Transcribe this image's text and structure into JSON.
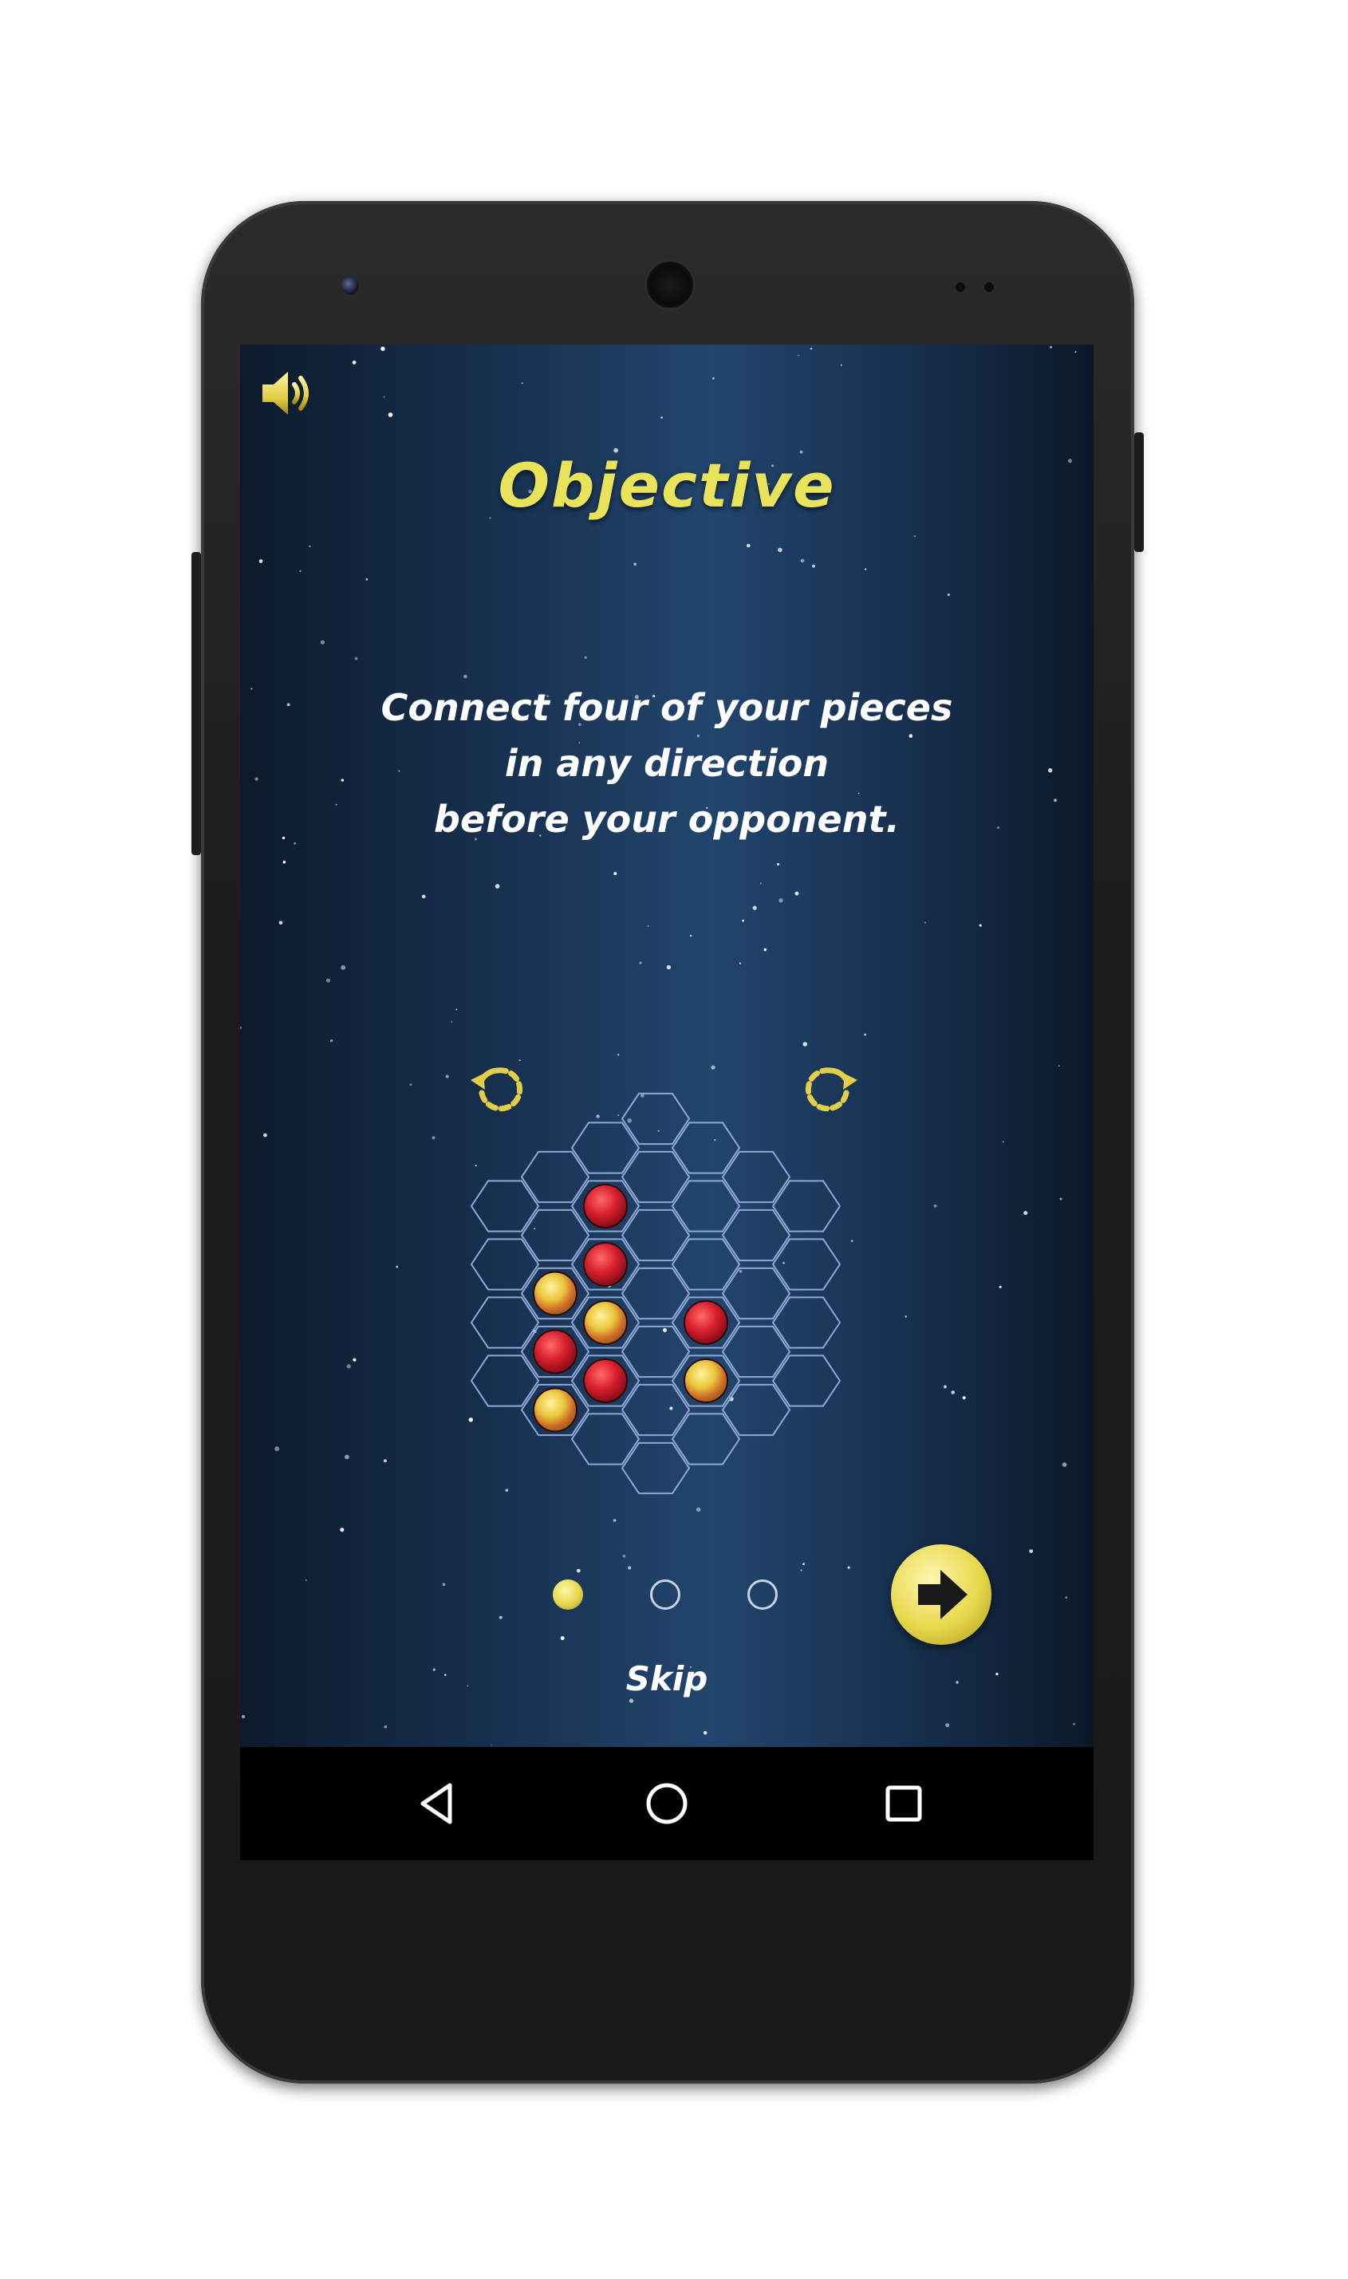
{
  "screen": {
    "title": "Objective",
    "description_lines": [
      "Connect four of your pieces",
      "in any direction",
      "before your opponent."
    ],
    "skip_label": "Skip",
    "pager": {
      "total": 3,
      "current": 1
    }
  },
  "board": {
    "pieces": [
      {
        "col": 2,
        "row": 1,
        "color": "red"
      },
      {
        "col": 1,
        "row": 2,
        "color": "yellow"
      },
      {
        "col": 2,
        "row": 2,
        "color": "red"
      },
      {
        "col": 1,
        "row": 3,
        "color": "red"
      },
      {
        "col": 2,
        "row": 3,
        "color": "yellow"
      },
      {
        "col": 4,
        "row": 3,
        "color": "red"
      },
      {
        "col": 1,
        "row": 4,
        "color": "yellow"
      },
      {
        "col": 2,
        "row": 4,
        "color": "red"
      },
      {
        "col": 4,
        "row": 4,
        "color": "yellow"
      }
    ]
  },
  "icons": {
    "sound": "speaker-volume-icon",
    "rotate_left": "rotate-left-icon",
    "rotate_right": "rotate-right-icon",
    "next": "arrow-right-icon",
    "nav_back": "triangle-back-icon",
    "nav_home": "circle-home-icon",
    "nav_recents": "square-recents-icon"
  },
  "colors": {
    "accent_yellow": "#e9e35c",
    "piece_red": "#d81f2e",
    "piece_yellow": "#e9c53a",
    "grid_line": "#8fa8d8"
  }
}
